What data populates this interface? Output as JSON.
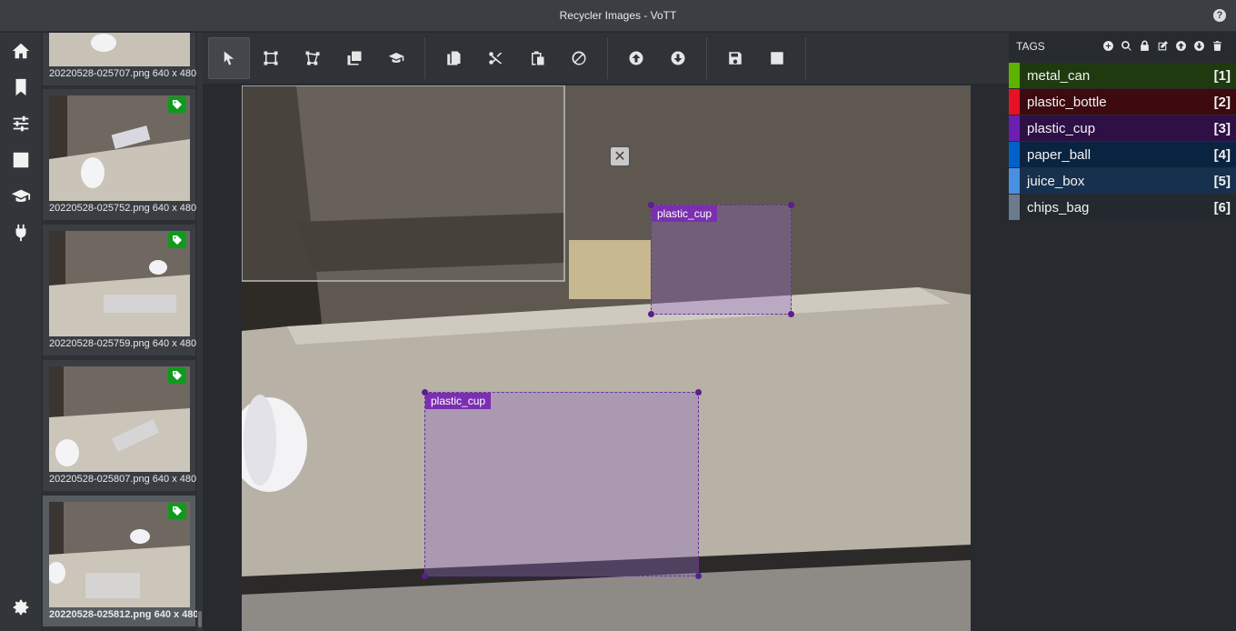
{
  "window": {
    "title": "Recycler Images - VoTT"
  },
  "nav": [
    "home-icon",
    "bookmark-icon",
    "sliders-icon",
    "export-icon",
    "graduation-cap-icon",
    "plug-icon"
  ],
  "thumbnails": [
    {
      "name": "20220528-025707.png",
      "size": "640 x 480",
      "tagged": false
    },
    {
      "name": "20220528-025752.png",
      "size": "640 x 480",
      "tagged": true
    },
    {
      "name": "20220528-025759.png",
      "size": "640 x 480",
      "tagged": true
    },
    {
      "name": "20220528-025807.png",
      "size": "640 x 480",
      "tagged": true
    },
    {
      "name": "20220528-025812.png",
      "size": "640 x 480",
      "tagged": true,
      "active": true
    }
  ],
  "toolbar": [
    "pointer-icon",
    "rectangle-icon",
    "polygon-icon",
    "copy-rectangle-icon",
    "active-learning-icon",
    "copy-icon",
    "cut-icon",
    "paste-icon",
    "clear-icon",
    "previous-icon",
    "next-icon",
    "save-icon",
    "export-icon"
  ],
  "regions": [
    {
      "tag": "plastic_cup"
    },
    {
      "tag": "plastic_cup"
    }
  ],
  "tags": {
    "title": "TAGS",
    "items": [
      {
        "name": "metal_can",
        "key": "[1]",
        "color": "#5db300",
        "bg": "#1f3a0f"
      },
      {
        "name": "plastic_bottle",
        "key": "[2]",
        "color": "#e81123",
        "bg": "#3d0a0f"
      },
      {
        "name": "plastic_cup",
        "key": "[3]",
        "color": "#6b1fb1",
        "bg": "#2e0f46"
      },
      {
        "name": "paper_ball",
        "key": "[4]",
        "color": "#0061cc",
        "bg": "#0a2340"
      },
      {
        "name": "juice_box",
        "key": "[5]",
        "color": "#4a90e2",
        "bg": "#17304d"
      },
      {
        "name": "chips_bag",
        "key": "[6]",
        "color": "#6b7b8c",
        "bg": "#24292f"
      }
    ]
  }
}
